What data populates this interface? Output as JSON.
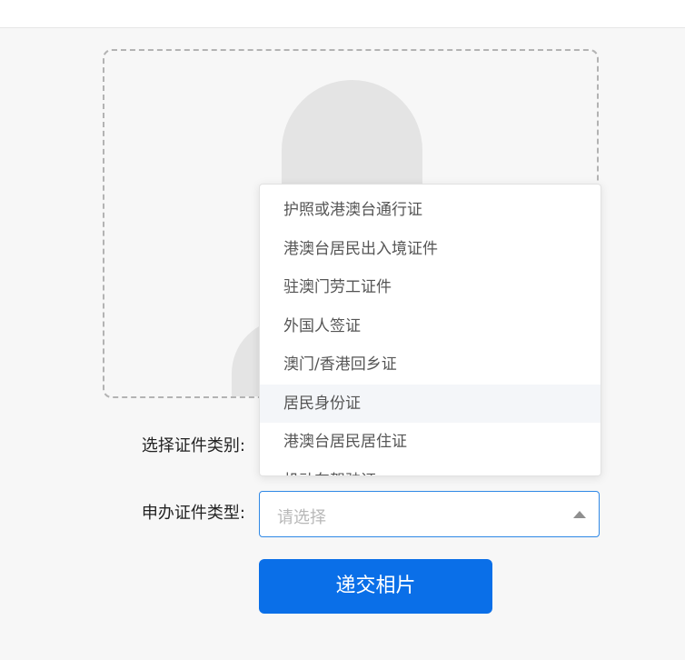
{
  "form": {
    "cert_category_label": "选择证件类别:",
    "apply_type_label": "申办证件类型:",
    "apply_type_placeholder": "请选择"
  },
  "dropdown": {
    "options": [
      "护照或港澳台通行证",
      "港澳台居民出入境证件",
      "驻澳门劳工证件",
      "外国人签证",
      "澳门/香港回乡证",
      "居民身份证",
      "港澳台居民居住证",
      "机动车驾驶证"
    ],
    "hovered_index": 5
  },
  "actions": {
    "submit_label": "递交相片"
  },
  "colors": {
    "accent": "#0a6fe8",
    "select_border": "#2f88e6",
    "hover_bg": "#f4f6f9"
  },
  "icons": {
    "select_arrow": "caret-up-icon",
    "photo_placeholder": "person-silhouette-icon"
  }
}
